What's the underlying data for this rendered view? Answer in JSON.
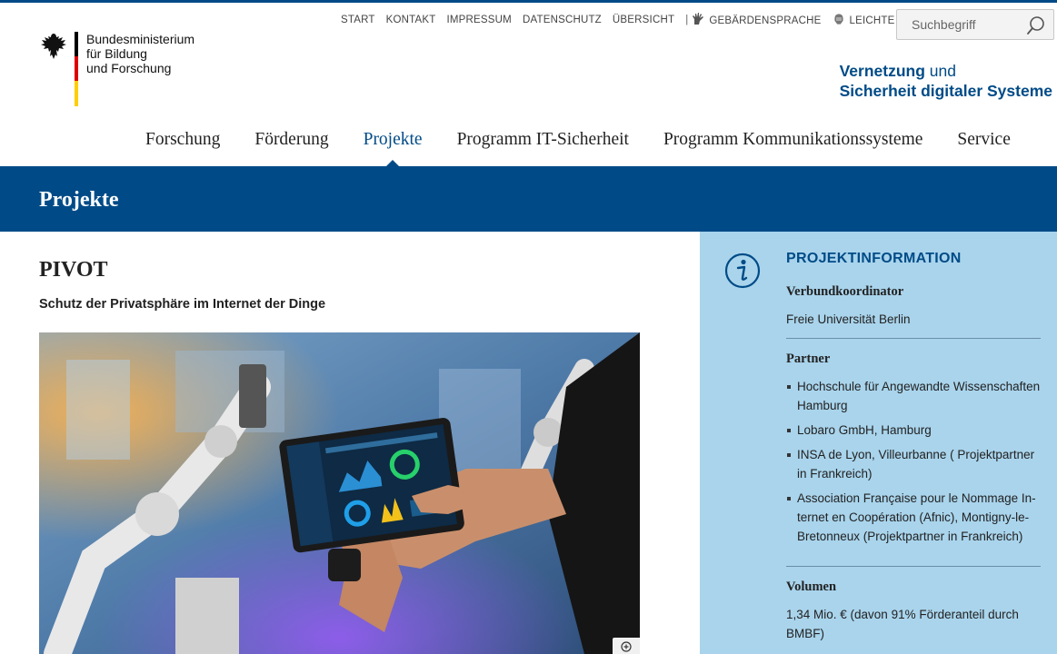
{
  "logo": {
    "lines": [
      "Bundesministerium",
      "für Bildung",
      "und Forschung"
    ]
  },
  "service_nav": {
    "items": [
      "START",
      "KONTAKT",
      "IMPRESSUM",
      "DATENSCHUTZ",
      "ÜBERSICHT"
    ],
    "separator": "|",
    "sign_language": "GEBÄRDENSPRACHE",
    "easy_language": "LEICHTE SPRACHE"
  },
  "search": {
    "placeholder": "Suchbegriff"
  },
  "site_title": {
    "line1_bold": "Vernetzung",
    "line1_rest": " und",
    "line2": "Sicherheit digitaler Systeme"
  },
  "main_nav": {
    "items": [
      "Forschung",
      "Förderung",
      "Projekte",
      "Programm IT-Sicherheit",
      "Programm Kommunikationssysteme",
      "Service"
    ],
    "active": "Projekte"
  },
  "banner": {
    "title": "Projekte"
  },
  "project": {
    "title": "PIVOT",
    "subtitle": "Schutz der Privatsphäre im Internet der Dinge"
  },
  "sidebar": {
    "heading": "PROJEKTINFORMATION",
    "coordinator_label": "Verbundkoordinator",
    "coordinator_value": "Freie Universität Berlin",
    "partner_label": "Partner",
    "partners": [
      "Hochschule für Angewandte Wissenschaften Hamburg",
      "Lobaro GmbH, Hamburg",
      "INSA de Lyon, Villeurbanne ( Projektpartner in Frankreich)",
      "Association Française pour le Nommage In­ternet en Coopération (Afnic), Montigny-le-Bretonneux (Projektpartner in Frankreich)"
    ],
    "volume_label": "Volumen",
    "volume_value": "1,34 Mio. € (davon 91% Förderanteil durch BMBF)"
  },
  "colors": {
    "brand_blue": "#004b87",
    "sidebar_bg": "#a9d4ec"
  }
}
